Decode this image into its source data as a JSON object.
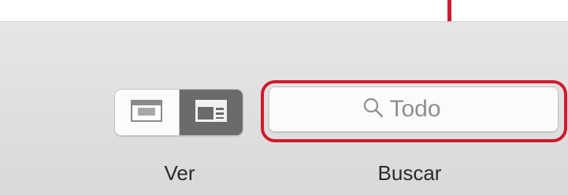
{
  "toolbar": {
    "view_group": {
      "label": "Ver",
      "icons": [
        "icon-view-icon",
        "list-view-icon"
      ],
      "selected_index": 1
    },
    "search": {
      "label": "Buscar",
      "placeholder": "Todo",
      "icon": "search-icon"
    }
  },
  "colors": {
    "callout": "#cf1a2d",
    "toolbar_bg": "#dedede",
    "segment_selected": "#6b6b6b",
    "segment_unselected": "#fbfbfb"
  }
}
